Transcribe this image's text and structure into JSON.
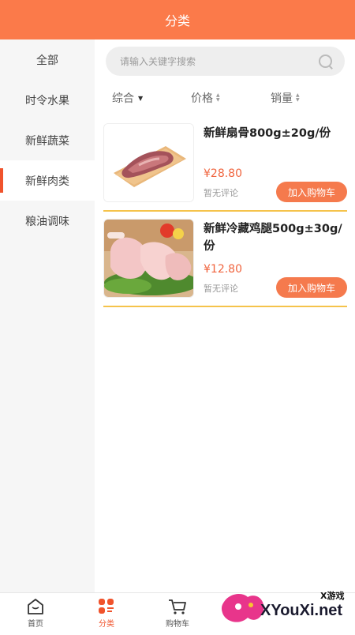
{
  "header": {
    "title": "分类"
  },
  "sidebar": {
    "items": [
      {
        "label": "全部"
      },
      {
        "label": "时令水果"
      },
      {
        "label": "新鲜蔬菜"
      },
      {
        "label": "新鲜肉类"
      },
      {
        "label": "粮油调味"
      }
    ],
    "active_index": 3
  },
  "search": {
    "placeholder": "请输入关键字搜索",
    "icon": "search-icon"
  },
  "sort": {
    "composite": "综合",
    "price": "价格",
    "sales": "销量"
  },
  "products": [
    {
      "name": "新鲜扇骨800g±20g/份",
      "price": "¥28.80",
      "review": "暂无评论",
      "button": "加入购物车",
      "image": "pork-bone-image"
    },
    {
      "name": "新鲜冷藏鸡腿500g±30g/份",
      "price": "¥12.80",
      "review": "暂无评论",
      "button": "加入购物车",
      "image": "chicken-leg-image"
    }
  ],
  "tabbar": {
    "items": [
      {
        "label": "首页",
        "icon": "home-icon"
      },
      {
        "label": "分类",
        "icon": "category-icon"
      },
      {
        "label": "购物车",
        "icon": "cart-icon"
      }
    ],
    "active_index": 1
  },
  "watermark": {
    "top": "X游戏",
    "main": "XYouXi.net"
  },
  "colors": {
    "accent": "#fb7a4a",
    "price": "#f0643e",
    "divider": "#f5c34b"
  }
}
